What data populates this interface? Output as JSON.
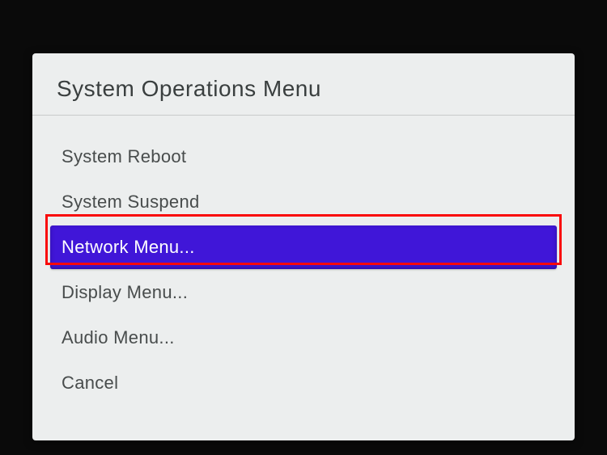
{
  "menu": {
    "title": "System Operations Menu",
    "items": [
      {
        "label": "System Reboot",
        "selected": false
      },
      {
        "label": "System Suspend",
        "selected": false
      },
      {
        "label": "Network Menu...",
        "selected": true
      },
      {
        "label": "Display Menu...",
        "selected": false
      },
      {
        "label": "Audio Menu...",
        "selected": false
      },
      {
        "label": "Cancel",
        "selected": false
      }
    ]
  },
  "annotation": {
    "highlighted_item": "Network Menu..."
  }
}
